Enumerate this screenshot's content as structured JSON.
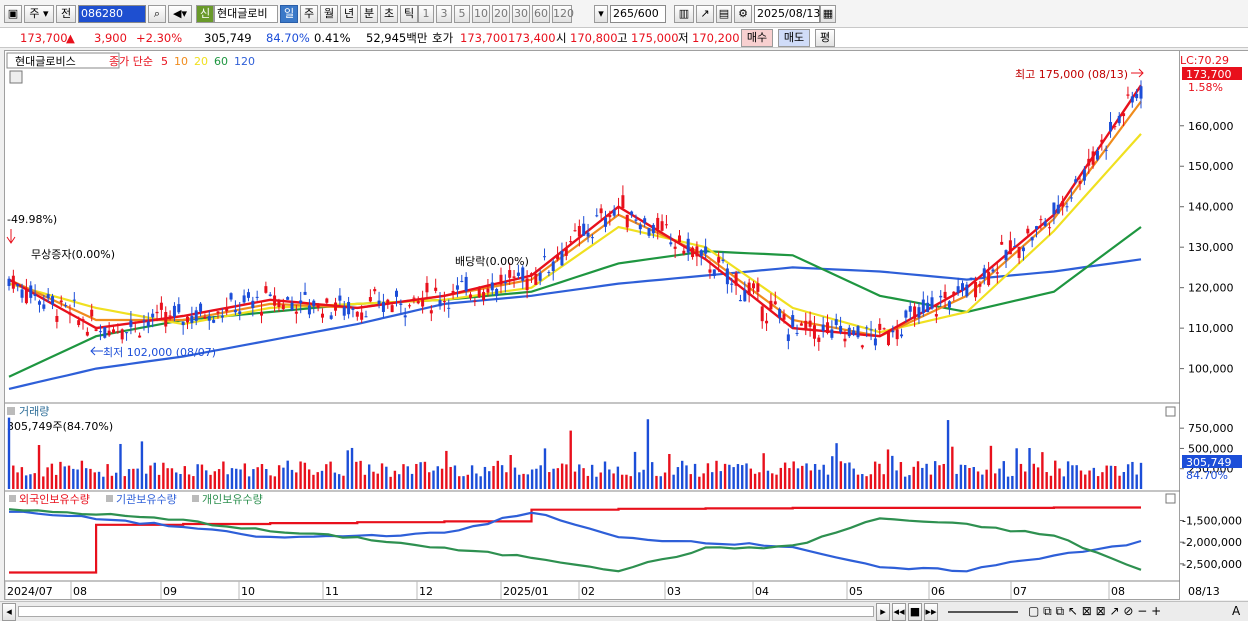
{
  "toolbar": {
    "type_label": "주",
    "prev_label": "전",
    "code": "086280",
    "sin_badge": "신",
    "stock_name": "현대글로비",
    "periods": [
      "일",
      "주",
      "월",
      "년",
      "분",
      "초",
      "틱"
    ],
    "intervals": [
      "1",
      "3",
      "5",
      "10",
      "20",
      "30",
      "60",
      "120"
    ],
    "count": "265",
    "count_total": "/600",
    "date": "2025/08/13"
  },
  "quote": {
    "price": "173,700",
    "change": "3,900",
    "change_pct": "+2.30%",
    "volume": "305,749",
    "volume_pct": "84.70%",
    "turnover": "0.41%",
    "amount": "52,945백만",
    "hoga_label": "호가",
    "ask": "173,700",
    "bid": "173,400",
    "open_label": "시",
    "open": "170,800",
    "high_label": "고",
    "high": "175,000",
    "low_label": "저",
    "low": "170,200",
    "buy_label": "매수",
    "sell_label": "매도",
    "pyeong_label": "평"
  },
  "price_pane": {
    "stock_tag": "현대글로비스",
    "ma_title": "종가 단순",
    "ma_periods": [
      "5",
      "10",
      "20",
      "60",
      "120"
    ],
    "ma_colors": [
      "#e8101c",
      "#f08c1c",
      "#f0e020",
      "#1e9640",
      "#2e5fd8"
    ],
    "annotations": {
      "high_label": "최고 175,000 (08/13)",
      "low_label": "최저 102,000 (08/07)",
      "pct_label": "-49.98%)",
      "bonus_label": "무상증자(0.00%)",
      "div_label": "배당락(0.00%)"
    },
    "lc_label": "LC:70.29",
    "price_box": "173,700",
    "pct_box": "1.58%",
    "y_ticks": [
      "160,000",
      "150,000",
      "140,000",
      "130,000",
      "120,000",
      "110,000",
      "100,000"
    ]
  },
  "volume_pane": {
    "title": "거래량",
    "value_label": "305,749주(84.70%)",
    "y_ticks": [
      "750,000",
      "500,000",
      "250,000"
    ],
    "box_value": "305,749",
    "box_pct": "84.70%"
  },
  "holdings_pane": {
    "series": [
      {
        "name": "외국인보유수량",
        "color": "#e8101c"
      },
      {
        "name": "기관보유수량",
        "color": "#2e5fd8"
      },
      {
        "name": "개인보유수량",
        "color": "#2e9050"
      }
    ],
    "y_ticks": [
      "-1,500,000",
      "-2,000,000",
      "-2,500,000"
    ]
  },
  "x_axis": {
    "labels": [
      "2024/07",
      "08",
      "09",
      "10",
      "11",
      "12",
      "2025/01",
      "02",
      "03",
      "04",
      "05",
      "06",
      "07",
      "08"
    ],
    "right_label": "08/13"
  },
  "colors": {
    "up": "#e8101c",
    "down": "#1c4ed8",
    "accent": "#3a78c8"
  },
  "chart_data": {
    "type": "line",
    "note_title": "",
    "price_ma": {
      "x": [
        "2024/07",
        "08",
        "09",
        "10",
        "11",
        "12",
        "2025/01",
        "02",
        "03",
        "04",
        "05",
        "06",
        "07",
        "08"
      ],
      "series": [
        {
          "name": "5",
          "values": [
            122000,
            110000,
            113000,
            117000,
            115000,
            118000,
            123000,
            140000,
            127000,
            110000,
            108000,
            120000,
            138000,
            170000
          ]
        },
        {
          "name": "10",
          "values": [
            122000,
            112000,
            112000,
            116000,
            115000,
            118000,
            122000,
            138000,
            128000,
            112000,
            108000,
            118000,
            137000,
            166000
          ]
        },
        {
          "name": "20",
          "values": [
            121000,
            115000,
            111000,
            115000,
            116000,
            117000,
            120000,
            135000,
            130000,
            115000,
            109000,
            114000,
            134000,
            158000
          ]
        },
        {
          "name": "60",
          "values": [
            98000,
            108000,
            112000,
            114000,
            116000,
            117000,
            119000,
            126000,
            129000,
            128000,
            118000,
            114000,
            119000,
            135000
          ]
        },
        {
          "name": "120",
          "values": [
            95000,
            100000,
            103000,
            107000,
            111000,
            116000,
            118000,
            121000,
            123000,
            125000,
            124000,
            122000,
            124000,
            127000
          ]
        }
      ],
      "ylim": [
        92000,
        176000
      ]
    },
    "holdings": {
      "x": [
        "2024/07",
        "08",
        "09",
        "10",
        "11",
        "12",
        "2025/01",
        "02",
        "03",
        "04",
        "05",
        "06",
        "07",
        "08"
      ],
      "series": [
        {
          "name": "외국인보유수량",
          "values": [
            -2700000,
            -1600000,
            -1580000,
            -1560000,
            -1540000,
            -1520000,
            -1250000,
            -1230000,
            -1220000,
            -1210000,
            -1210000,
            -1210000,
            -1200000,
            -1200000
          ]
        },
        {
          "name": "기관보유수량",
          "values": [
            -1300000,
            -1450000,
            -1650000,
            -1900000,
            -1850000,
            -1800000,
            -1300000,
            -1900000,
            -2000000,
            -2100000,
            -2600000,
            -2650000,
            -2300000,
            -2000000
          ]
        },
        {
          "name": "개인보유수량",
          "values": [
            -1250000,
            -1350000,
            -1500000,
            -1750000,
            -1900000,
            -2150000,
            -2350000,
            -2650000,
            -2150000,
            -2100000,
            -1450000,
            -1600000,
            -1850000,
            -2650000
          ]
        }
      ],
      "ylim": [
        -2850000,
        -1050000
      ]
    }
  }
}
